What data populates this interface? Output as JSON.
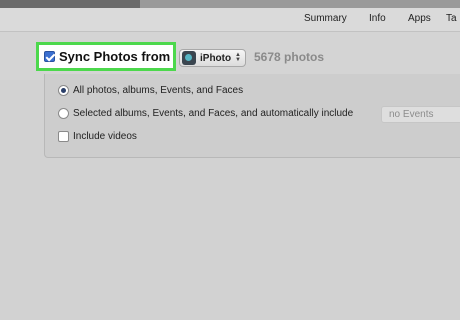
{
  "tabs": [
    {
      "label": "Summary"
    },
    {
      "label": "Info"
    },
    {
      "label": "Apps"
    },
    {
      "label": "Ta"
    }
  ],
  "sync": {
    "label": "Sync Photos from",
    "checked": true,
    "source": "iPhoto",
    "source_icon": "iphoto-icon",
    "count": "5678 photos"
  },
  "options": {
    "all_label": "All photos, albums, Events, and Faces",
    "selected_label": "Selected albums, Events, and Faces, and automatically include",
    "events_value": "no Events",
    "videos_label": "Include videos"
  },
  "colors": {
    "highlight": "#4cd84c",
    "checkbox_blue": "#3a6fd0"
  }
}
